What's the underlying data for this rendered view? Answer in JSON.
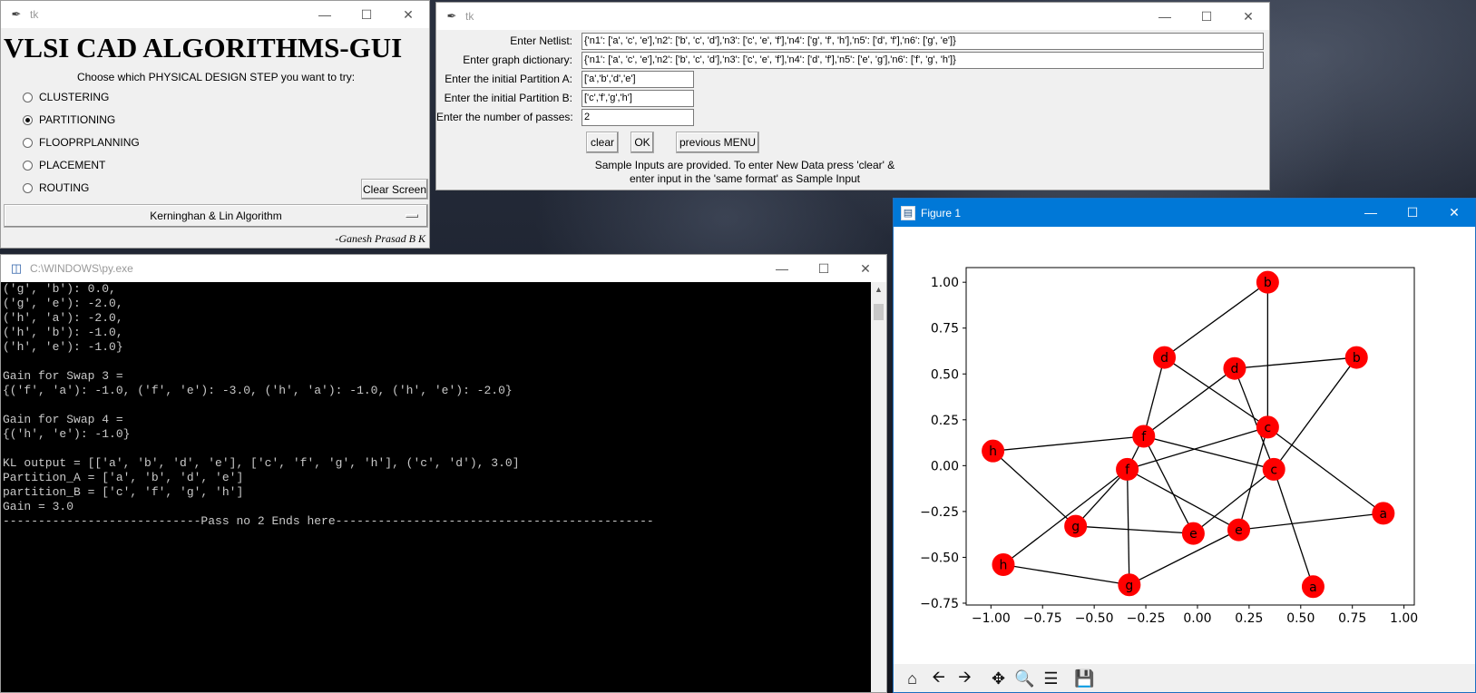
{
  "menu_window": {
    "title": "tk",
    "heading": "VLSI CAD ALGORITHMS-GUI",
    "prompt": "Choose which PHYSICAL DESIGN STEP you want to try:",
    "options": [
      {
        "label": "CLUSTERING",
        "selected": false
      },
      {
        "label": "PARTITIONING",
        "selected": true
      },
      {
        "label": "FLOOPRPLANNING",
        "selected": false
      },
      {
        "label": "PLACEMENT",
        "selected": false
      },
      {
        "label": "ROUTING",
        "selected": false
      }
    ],
    "clear_screen_label": "Clear Screen",
    "algorithm_selected": "Kerninghan & Lin Algorithm",
    "signature": "-Ganesh Prasad B K"
  },
  "input_window": {
    "title": "tk",
    "fields": [
      {
        "label": "Enter Netlist:",
        "value": "{'n1': ['a', 'c', 'e'],'n2': ['b', 'c', 'd'],'n3': ['c', 'e', 'f'],'n4': ['g', 'f', 'h'],'n5': ['d', 'f'],'n6': ['g', 'e']}"
      },
      {
        "label": "Enter graph dictionary:",
        "value": "{'n1': ['a', 'c', 'e'],'n2': ['b', 'c', 'd'],'n3': ['c', 'e', 'f'],'n4': ['d', 'f'],'n5': ['e', 'g'],'n6': ['f', 'g', 'h']}"
      },
      {
        "label": "Enter the initial Partition A:",
        "value": "['a','b','d','e']"
      },
      {
        "label": "Enter the initial Partition B:",
        "value": "['c','f','g','h']"
      },
      {
        "label": "Enter the number of passes:",
        "value": "2"
      }
    ],
    "clear_label": "clear",
    "ok_label": "OK",
    "previous_menu_label": "previous MENU",
    "note_line1": "Sample Inputs are provided. To enter New Data press 'clear' &",
    "note_line2": "enter input in the 'same format' as Sample Input"
  },
  "console_window": {
    "title": "C:\\WINDOWS\\py.exe",
    "lines": [
      "('g', 'b'): 0.0,",
      "('g', 'e'): -2.0,",
      "('h', 'a'): -2.0,",
      "('h', 'b'): -1.0,",
      "('h', 'e'): -1.0}",
      "",
      "Gain for Swap 3 =",
      "{('f', 'a'): -1.0, ('f', 'e'): -3.0, ('h', 'a'): -1.0, ('h', 'e'): -2.0}",
      "",
      "Gain for Swap 4 =",
      "{('h', 'e'): -1.0}",
      "",
      "KL output = [['a', 'b', 'd', 'e'], ['c', 'f', 'g', 'h'], ('c', 'd'), 3.0]",
      "Partition_A = ['a', 'b', 'd', 'e']",
      "partition_B = ['c', 'f', 'g', 'h']",
      "Gain = 3.0",
      "----------------------------Pass no 2 Ends here---------------------------------------------"
    ]
  },
  "figure_window": {
    "title": "Figure 1",
    "toolbar": [
      "home-icon",
      "back-icon",
      "forward-icon",
      "pan-icon",
      "zoom-icon",
      "configure-icon",
      "save-icon"
    ]
  },
  "chart_data": {
    "type": "scatter",
    "title": "",
    "xlabel": "",
    "ylabel": "",
    "xlim": [
      -1.12,
      1.05
    ],
    "ylim": [
      -0.76,
      1.08
    ],
    "xticks": [
      -1.0,
      -0.75,
      -0.5,
      -0.25,
      0.0,
      0.25,
      0.5,
      0.75,
      1.0
    ],
    "yticks": [
      -0.75,
      -0.5,
      -0.25,
      0.0,
      0.25,
      0.5,
      0.75,
      1.0
    ],
    "xtick_labels": [
      "−1.00",
      "−0.75",
      "−0.50",
      "−0.25",
      "0.00",
      "0.25",
      "0.50",
      "0.75",
      "1.00"
    ],
    "ytick_labels": [
      "−0.75",
      "−0.50",
      "−0.25",
      "0.00",
      "0.25",
      "0.50",
      "0.75",
      "1.00"
    ],
    "node_color": "#ff0000",
    "edge_color": "#000000",
    "grid": false,
    "nodes": [
      {
        "id": "b1",
        "label": "b",
        "x": 0.34,
        "y": 1.0
      },
      {
        "id": "d1",
        "label": "d",
        "x": -0.16,
        "y": 0.59
      },
      {
        "id": "d2",
        "label": "d",
        "x": 0.18,
        "y": 0.53
      },
      {
        "id": "b2",
        "label": "b",
        "x": 0.77,
        "y": 0.59
      },
      {
        "id": "c1",
        "label": "c",
        "x": 0.34,
        "y": 0.21
      },
      {
        "id": "f1",
        "label": "f",
        "x": -0.26,
        "y": 0.16
      },
      {
        "id": "h1",
        "label": "h",
        "x": -0.99,
        "y": 0.08
      },
      {
        "id": "f2",
        "label": "f",
        "x": -0.34,
        "y": -0.02
      },
      {
        "id": "c2",
        "label": "c",
        "x": 0.37,
        "y": -0.02
      },
      {
        "id": "a1",
        "label": "a",
        "x": 0.9,
        "y": -0.26
      },
      {
        "id": "g1",
        "label": "g",
        "x": -0.59,
        "y": -0.33
      },
      {
        "id": "e1",
        "label": "e",
        "x": -0.02,
        "y": -0.37
      },
      {
        "id": "e2",
        "label": "e",
        "x": 0.2,
        "y": -0.35
      },
      {
        "id": "h2",
        "label": "h",
        "x": -0.94,
        "y": -0.54
      },
      {
        "id": "g2",
        "label": "g",
        "x": -0.33,
        "y": -0.65
      },
      {
        "id": "a2",
        "label": "a",
        "x": 0.56,
        "y": -0.66
      }
    ],
    "edges": [
      [
        "b1",
        "d1"
      ],
      [
        "b1",
        "c1"
      ],
      [
        "d1",
        "f1"
      ],
      [
        "d1",
        "c1"
      ],
      [
        "d2",
        "b2"
      ],
      [
        "d2",
        "f1"
      ],
      [
        "d2",
        "c2"
      ],
      [
        "b2",
        "c2"
      ],
      [
        "c1",
        "f2"
      ],
      [
        "c1",
        "e2"
      ],
      [
        "c1",
        "a1"
      ],
      [
        "f1",
        "h1"
      ],
      [
        "f1",
        "c2"
      ],
      [
        "f1",
        "e1"
      ],
      [
        "f1",
        "f2"
      ],
      [
        "h1",
        "g1"
      ],
      [
        "f2",
        "g1"
      ],
      [
        "f2",
        "h2"
      ],
      [
        "f2",
        "g2"
      ],
      [
        "f2",
        "e2"
      ],
      [
        "c2",
        "e1"
      ],
      [
        "c2",
        "a2"
      ],
      [
        "g1",
        "e1"
      ],
      [
        "e2",
        "a1"
      ],
      [
        "h2",
        "g2"
      ],
      [
        "g2",
        "e2"
      ]
    ]
  }
}
